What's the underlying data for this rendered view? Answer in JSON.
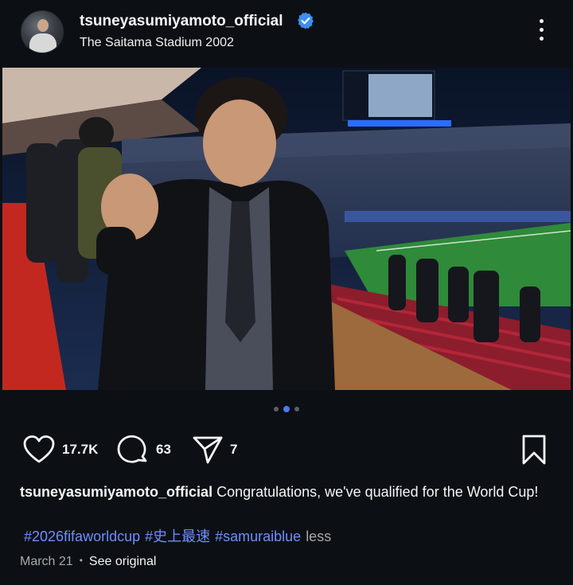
{
  "header": {
    "username": "tsuneyasumiyamoto_official",
    "location": "The Saitama Stadium 2002",
    "verified": true
  },
  "carousel": {
    "slide_count": 3,
    "active_index": 1
  },
  "actions": {
    "likes": "17.7K",
    "comments": "63",
    "shares": "7"
  },
  "caption": {
    "username": "tsuneyasumiyamoto_official",
    "text": "Congratulations, we've qualified for the World Cup!",
    "tags": [
      "#2026fifaworldcup",
      "#史上最速",
      "#samuraiblue"
    ],
    "less_label": "less"
  },
  "meta": {
    "date": "March 21",
    "separator": "•",
    "see_original": "See original"
  },
  "colors": {
    "background": "#0c1014",
    "link": "#6f8dff",
    "verified": "#3d8ef0",
    "muted": "#a8a8a8"
  },
  "icons": [
    "heart-icon",
    "comment-icon",
    "share-icon",
    "bookmark-icon",
    "verified-icon",
    "more-icon"
  ]
}
